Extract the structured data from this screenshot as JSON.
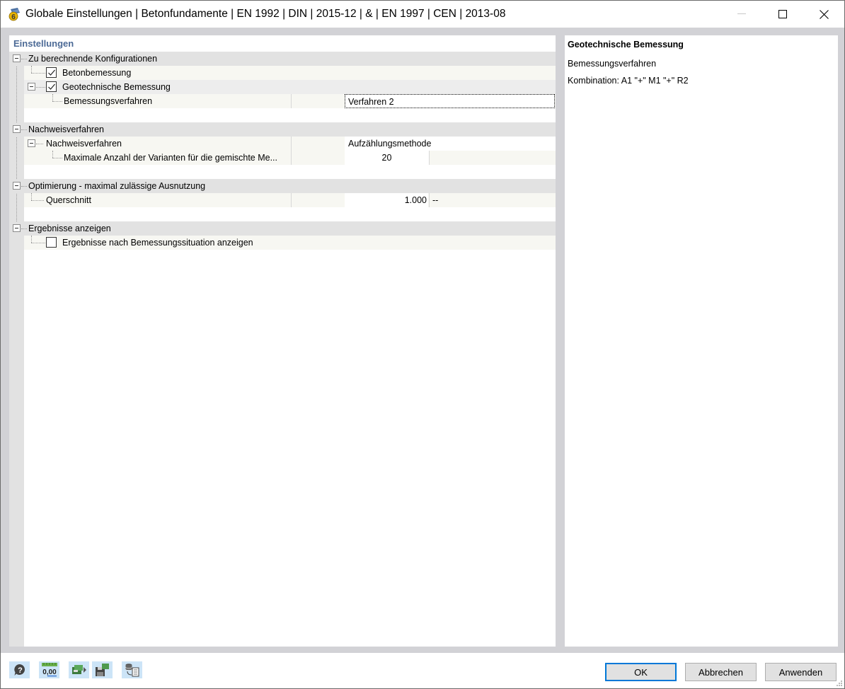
{
  "window": {
    "title": "Globale Einstellungen | Betonfundamente | EN 1992 | DIN | 2015-12 | & | EN 1997 | CEN | 2013-08",
    "icon": "rfem-6-app-icon",
    "controls": {
      "minimize": "minimize-icon",
      "maximize": "maximize-icon",
      "close": "close-icon"
    }
  },
  "settings": {
    "header": "Einstellungen",
    "groups": [
      {
        "label": "Zu berechnende Konfigurationen",
        "expanded": true,
        "items": [
          {
            "label": "Betonbemessung",
            "checked": true
          },
          {
            "label": "Geotechnische Bemessung",
            "checked": true,
            "expanded": true,
            "children": [
              {
                "label": "Bemessungsverfahren",
                "value": "Verfahren 2"
              }
            ]
          }
        ]
      },
      {
        "label": "Nachweisverfahren",
        "expanded": true,
        "items": [
          {
            "label": "Nachweisverfahren",
            "value": "Aufzählungsmethode",
            "expanded": true,
            "children": [
              {
                "label": "Maximale Anzahl der Varianten für die gemischte Me...",
                "value": "20"
              }
            ]
          }
        ]
      },
      {
        "label": "Optimierung - maximal zulässige Ausnutzung",
        "expanded": true,
        "items": [
          {
            "label": "Querschnitt",
            "value": "1.000",
            "unit": "--"
          }
        ]
      },
      {
        "label": "Ergebnisse anzeigen",
        "expanded": true,
        "items": [
          {
            "label": "Ergebnisse nach Bemessungssituation anzeigen",
            "checked": false
          }
        ]
      }
    ]
  },
  "info": {
    "title": "Geotechnische Bemessung",
    "line1": "Bemessungsverfahren",
    "line2": "Kombination: A1 \"+\" M1 \"+\" R2"
  },
  "footer": {
    "tools": [
      "help-icon",
      "units-decimals-icon",
      "load-defaults-icon",
      "save-defaults-icon",
      "copy-from-database-icon"
    ],
    "units_icon_text": "0,00",
    "ok": "OK",
    "cancel": "Abbrechen",
    "apply": "Anwenden"
  },
  "colors": {
    "header_text": "#4c6a96",
    "frame": "#d2d2d6",
    "group_row": "#e2e2e2",
    "item_row": "#f7f7f2",
    "primary_border": "#0078d7",
    "tool_bg": "#cce4f7"
  }
}
